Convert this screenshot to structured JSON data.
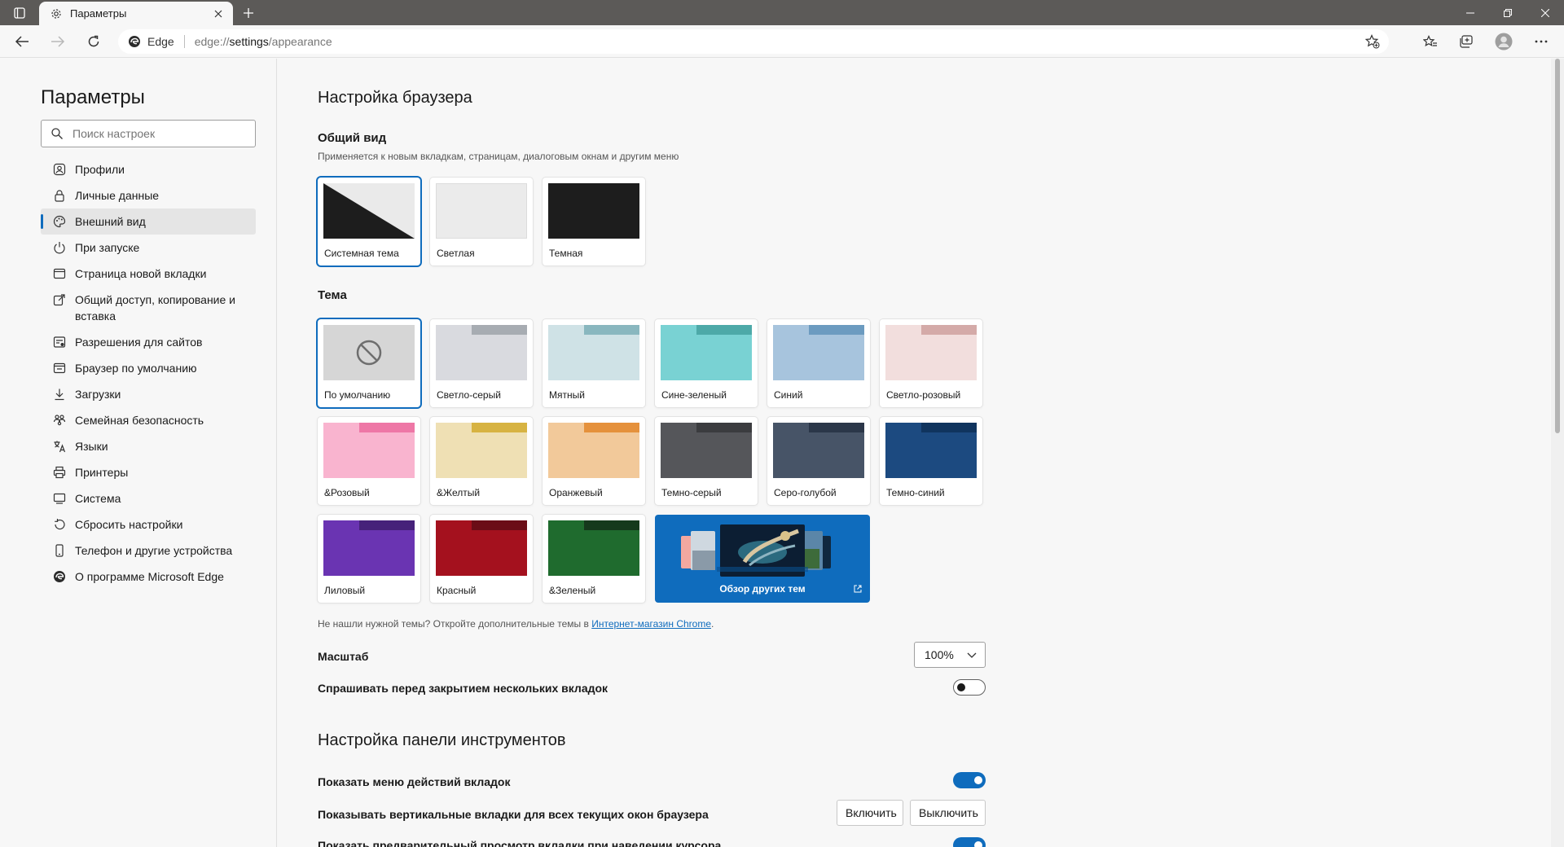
{
  "browser": {
    "tab_title": "Параметры",
    "address_brand": "Edge",
    "address_scheme": "edge://",
    "address_path": "settings",
    "address_rest": "/appearance"
  },
  "sidebar": {
    "title": "Параметры",
    "search_placeholder": "Поиск настроек",
    "items": [
      {
        "label": "Профили",
        "icon": "profile-icon"
      },
      {
        "label": "Личные данные",
        "icon": "lock-icon"
      },
      {
        "label": "Внешний вид",
        "icon": "palette-icon",
        "active": true
      },
      {
        "label": "При запуске",
        "icon": "power-icon"
      },
      {
        "label": "Страница новой вкладки",
        "icon": "new-tab-page-icon"
      },
      {
        "label": "Общий доступ, копирование и вставка",
        "icon": "share-icon"
      },
      {
        "label": "Разрешения для сайтов",
        "icon": "site-permissions-icon"
      },
      {
        "label": "Браузер по умолчанию",
        "icon": "default-browser-icon"
      },
      {
        "label": "Загрузки",
        "icon": "download-icon"
      },
      {
        "label": "Семейная безопасность",
        "icon": "family-icon"
      },
      {
        "label": "Языки",
        "icon": "languages-icon"
      },
      {
        "label": "Принтеры",
        "icon": "printer-icon"
      },
      {
        "label": "Система",
        "icon": "system-icon"
      },
      {
        "label": "Сбросить настройки",
        "icon": "reset-icon"
      },
      {
        "label": "Телефон и другие устройства",
        "icon": "phone-icon"
      },
      {
        "label": "О программе Microsoft Edge",
        "icon": "edge-logo-icon"
      }
    ]
  },
  "appearance": {
    "title": "Настройка браузера",
    "general": {
      "title": "Общий вид",
      "description": "Применяется к новым вкладкам, страницам, диалоговым окнам и другим меню",
      "options": [
        {
          "label": "Системная тема",
          "selected": true
        },
        {
          "label": "Светлая"
        },
        {
          "label": "Темная"
        }
      ]
    },
    "theme": {
      "title": "Тема",
      "default_label": "По умолчанию",
      "options": [
        {
          "label": "Светло-серый",
          "tab": "#a7acb2",
          "body": "#d9dadf"
        },
        {
          "label": "Мятный",
          "tab": "#89b7bf",
          "body": "#cfe2e6"
        },
        {
          "label": "Сине-зеленый",
          "tab": "#4da9a8",
          "body": "#79d2d3"
        },
        {
          "label": "Синий",
          "tab": "#6c9bc0",
          "body": "#a7c4dd"
        },
        {
          "label": "Светло-розовый",
          "tab": "#d4aaa8",
          "body": "#f2dedd"
        },
        {
          "label": "&Розовый",
          "tab": "#ee77a6",
          "body": "#f9b4cf"
        },
        {
          "label": "&Желтый",
          "tab": "#d7b342",
          "body": "#efe0b4"
        },
        {
          "label": "Оранжевый",
          "tab": "#e5913c",
          "body": "#f2c99a"
        },
        {
          "label": "Темно-серый",
          "tab": "#3b3c3f",
          "body": "#55565a"
        },
        {
          "label": "Серо-голубой",
          "tab": "#2b3749",
          "body": "#475467"
        },
        {
          "label": "Темно-синий",
          "tab": "#10345e",
          "body": "#1c4a80"
        },
        {
          "label": "Лиловый",
          "tab": "#46227a",
          "body": "#6a34b2"
        },
        {
          "label": "Красный",
          "tab": "#6b0d17",
          "body": "#a4111e"
        },
        {
          "label": "&Зеленый",
          "tab": "#15391c",
          "body": "#1f6b2e"
        }
      ],
      "explore_label": "Обзор других тем",
      "note_text": "Не нашли нужной темы? Откройте дополнительные темы в ",
      "note_link": "Интернет-магазин Chrome",
      "note_end": "."
    },
    "zoom": {
      "label": "Масштаб",
      "value": "100%"
    },
    "ask_close": {
      "label": "Спрашивать перед закрытием нескольких вкладок",
      "enabled": false
    }
  },
  "toolbar_settings": {
    "title": "Настройка панели инструментов",
    "tab_actions": {
      "label": "Показать меню действий вкладок",
      "enabled": true
    },
    "vertical_tabs": {
      "label": "Показывать вертикальные вкладки для всех текущих окон браузера",
      "on_label": "Включить",
      "off_label": "Выключить"
    },
    "preview": {
      "label": "Показать предварительный просмотр вкладки при наведении курсора",
      "enabled": true
    }
  },
  "colors": {
    "accent": "#0f6cbd"
  }
}
